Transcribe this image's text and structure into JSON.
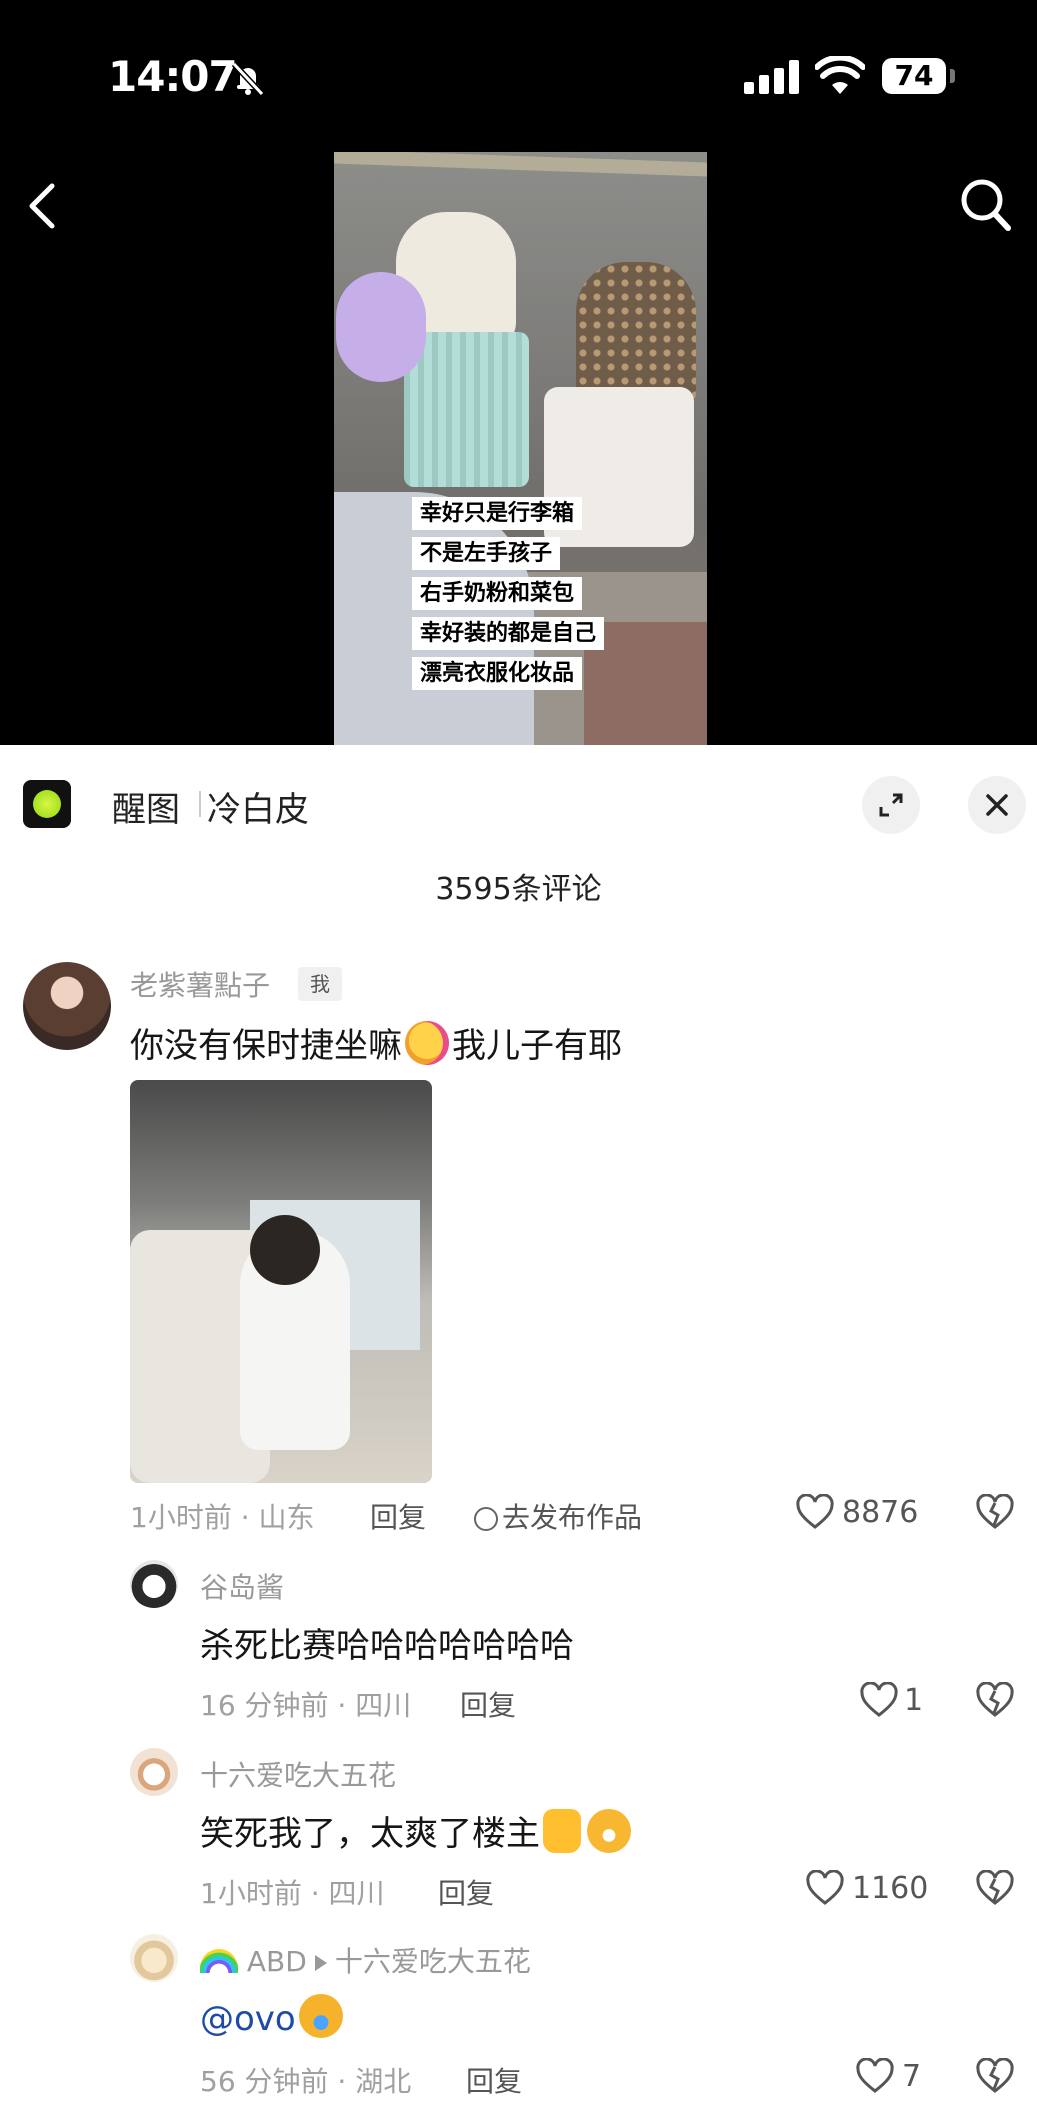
{
  "status_bar": {
    "time": "14:07",
    "battery": "74"
  },
  "video": {
    "caption_lines": [
      "幸好只是行李箱",
      "不是左手孩子",
      "右手奶粉和菜包",
      "幸好装的都是自己",
      "漂亮衣服化妆品"
    ]
  },
  "sheet": {
    "app_name": "醒图",
    "app_subtitle": "冷白皮",
    "comment_count": "3595条评论"
  },
  "comments": [
    {
      "username": "老紫薯點子",
      "tag": "我",
      "text_before": "你没有保时捷坐嘛",
      "text_after": "我儿子有耶",
      "meta": "1小时前 · 山东",
      "reply_label": "回复",
      "publish_label": "去发布作品",
      "likes": "8876"
    }
  ],
  "replies": [
    {
      "username": "谷岛酱",
      "text": "杀死比赛哈哈哈哈哈哈哈",
      "meta": "16 分钟前 · 四川",
      "reply_label": "回复",
      "likes": "1"
    },
    {
      "username": "十六爱吃大五花",
      "text": "笑死我了，太爽了楼主",
      "meta": "1小时前 · 四川",
      "reply_label": "回复",
      "likes": "1160"
    },
    {
      "username": "ABD",
      "reply_to": "十六爱吃大五花",
      "text": "@ovo",
      "meta": "56 分钟前 · 湖北",
      "reply_label": "回复",
      "likes": "7"
    }
  ],
  "colors": {
    "accent_mention": "#1f4aa8",
    "logo_green": "#a6e21e"
  },
  "icons": [
    "bell-off-icon",
    "signal-icon",
    "wifi-icon",
    "back-icon",
    "search-icon",
    "expand-icon",
    "close-icon",
    "heart-icon",
    "dislike-icon"
  ]
}
